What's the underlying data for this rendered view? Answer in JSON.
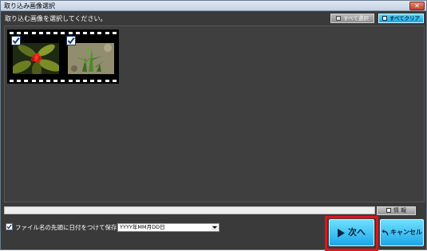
{
  "window": {
    "title": "取り込み画像選択",
    "close_label": "✕"
  },
  "instruction": "取り込む画像を選択してください。",
  "toolbar": {
    "select_all_label": "すべて選択",
    "clear_all_label": "すべてクリア"
  },
  "thumbnails": [
    {
      "checked": true,
      "subject": "red berries with green leaves"
    },
    {
      "checked": true,
      "subject": "green plant on soil"
    }
  ],
  "info_button_label": "情 報",
  "date_option": {
    "checked": true,
    "label": "ファイル名の先頭に日付をつけて保存",
    "selected_format": "YYYY年MM月DD日"
  },
  "buttons": {
    "next_label": "次へ",
    "cancel_label": "キャンセル"
  },
  "colors": {
    "panel_bg": "#3a3a3a",
    "accent_cyan": "#1ca6e8",
    "highlight_red": "#e0141c"
  }
}
